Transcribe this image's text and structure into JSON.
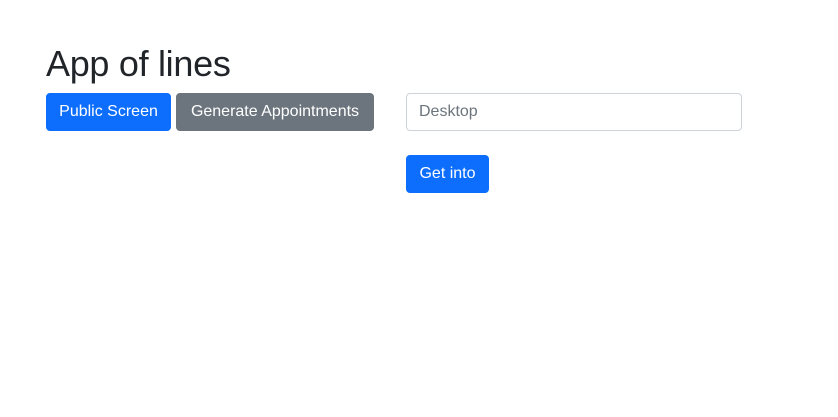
{
  "header": {
    "title": "App of lines"
  },
  "toolbar": {
    "public_screen_label": "Public Screen",
    "generate_appointments_label": "Generate Appointments"
  },
  "form": {
    "desktop_input": {
      "value": "",
      "placeholder": "Desktop"
    },
    "submit_label": "Get into"
  },
  "colors": {
    "primary": "#0d6efd",
    "secondary": "#6c757d",
    "input_border": "#ced4da",
    "text": "#212529"
  }
}
